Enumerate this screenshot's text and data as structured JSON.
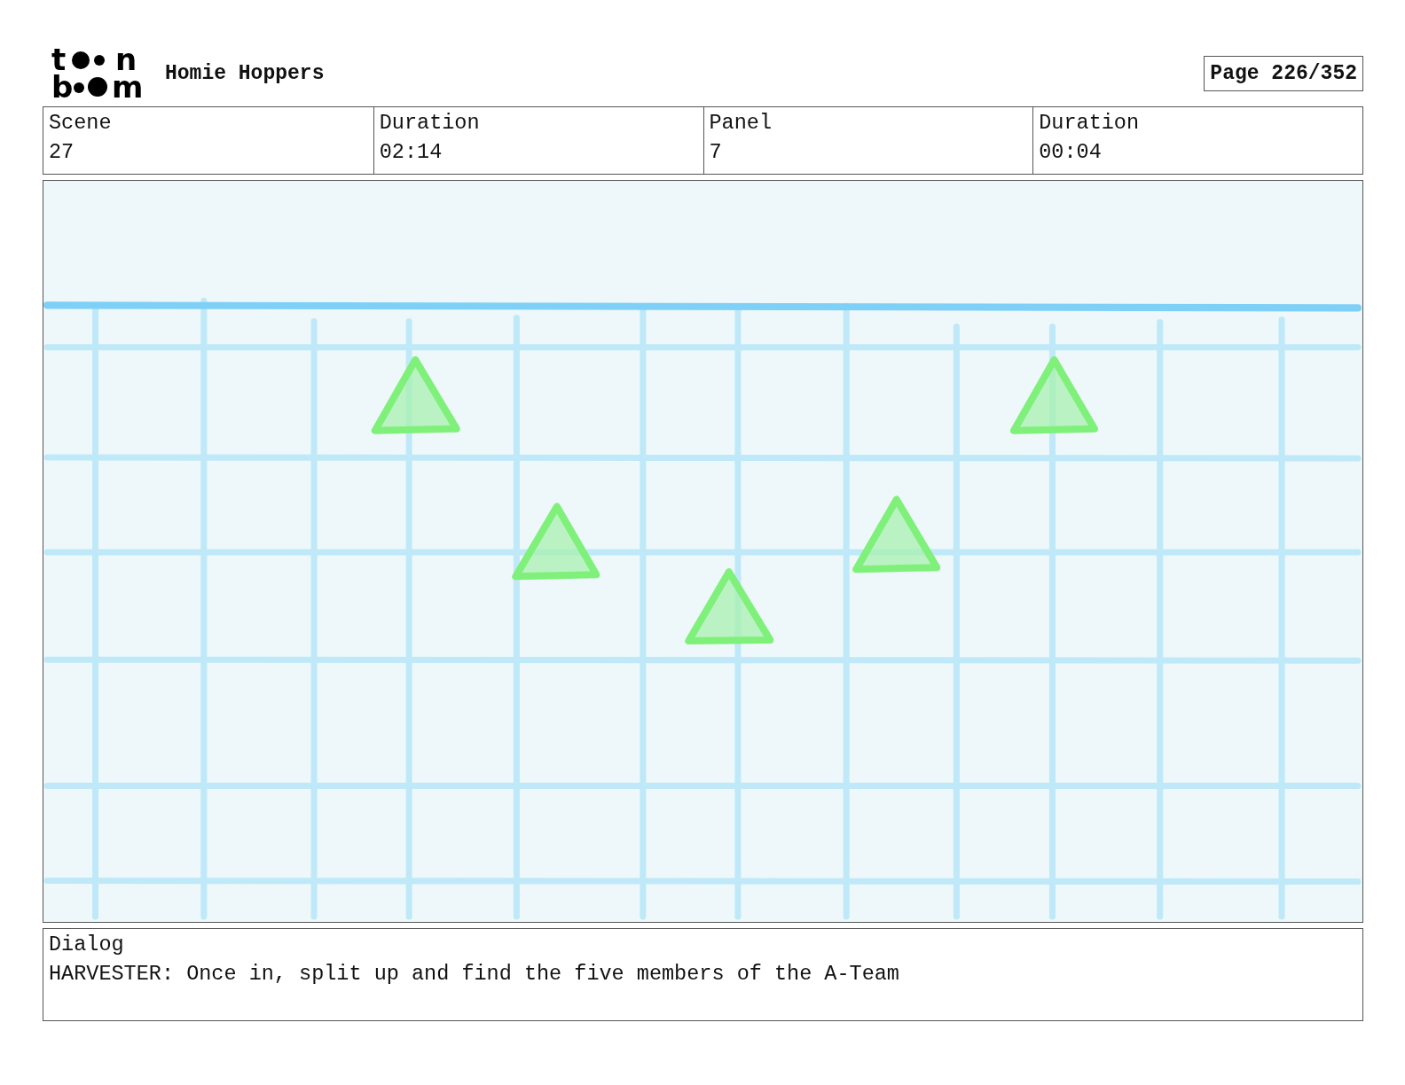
{
  "logo": {
    "lines": [
      [
        "t",
        "n"
      ],
      [
        "b",
        "m"
      ]
    ]
  },
  "project_title": "Homie Hoppers",
  "page_label": "Page 226/352",
  "info_fields": [
    {
      "label": "Scene",
      "value": "27"
    },
    {
      "label": "Duration",
      "value": "02:14"
    },
    {
      "label": "Panel",
      "value": "7"
    },
    {
      "label": "Duration",
      "value": "00:04"
    }
  ],
  "panel": {
    "kind": "sketch"
  },
  "dialog": {
    "label": "Dialog",
    "text": "HARVESTER: Once in, split up and find the five members of the A-Team"
  }
}
